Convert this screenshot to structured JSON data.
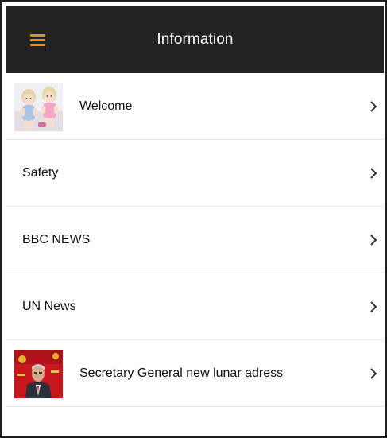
{
  "header": {
    "title": "Information",
    "accent_color": "#f08c1e",
    "bar_color": "#222222"
  },
  "list": {
    "items": [
      {
        "label": "Welcome",
        "thumbnail": "dolls-photo"
      },
      {
        "label": "Safety",
        "thumbnail": null
      },
      {
        "label": "BBC NEWS",
        "thumbnail": null
      },
      {
        "label": "UN News",
        "thumbnail": null
      },
      {
        "label": "Secretary General new lunar adress",
        "thumbnail": "speaker-photo"
      }
    ]
  }
}
